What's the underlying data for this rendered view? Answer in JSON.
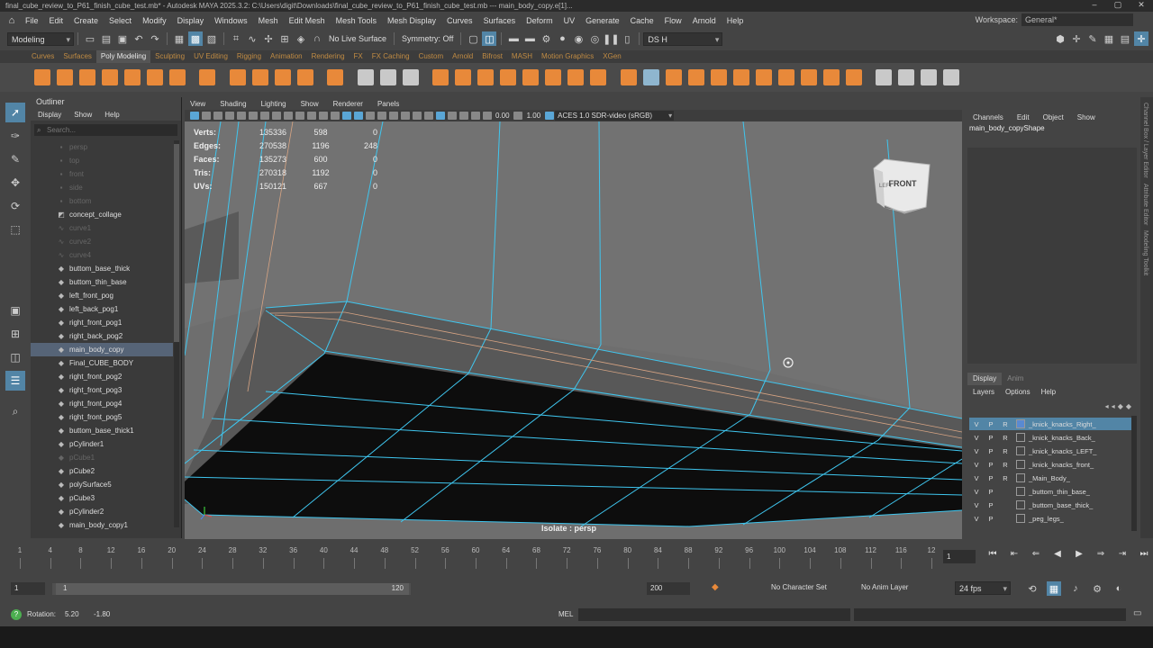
{
  "window": {
    "title": "final_cube_review_to_P61_finish_cube_test.mb* - Autodesk MAYA 2025.3.2: C:\\Users\\digit\\Downloads\\final_cube_review_to_P61_finish_cube_test.mb  ---  main_body_copy.e[1]...",
    "minimize": "–",
    "maximize": "▢",
    "close": "✕"
  },
  "menubar": {
    "items": [
      "File",
      "Edit",
      "Create",
      "Select",
      "Modify",
      "Display",
      "Windows",
      "Mesh",
      "Edit Mesh",
      "Mesh Tools",
      "Mesh Display",
      "Curves",
      "Surfaces",
      "Deform",
      "UV",
      "Generate",
      "Cache",
      "Flow",
      "Arnold",
      "Help"
    ],
    "workspace_label": "Workspace:",
    "workspace_value": "General*"
  },
  "statusline": {
    "menu_set": "Modeling",
    "live_surface": "No Live Surface",
    "symmetry": "Symmetry: Off",
    "user": "DS H"
  },
  "shelf": {
    "tabs": [
      "Curves",
      "Surfaces",
      "Poly Modeling",
      "Sculpting",
      "UV Editing",
      "Rigging",
      "Animation",
      "Rendering",
      "FX",
      "FX Caching",
      "Custom",
      "Arnold",
      "Bifrost",
      "MASH",
      "Motion Graphics",
      "XGen"
    ],
    "active_tab": "Poly Modeling"
  },
  "outliner": {
    "title": "Outliner",
    "menu": [
      "Display",
      "Show",
      "Help"
    ],
    "search_placeholder": "Search...",
    "items": [
      {
        "label": "persp",
        "dim": true,
        "icon": "camera-icon"
      },
      {
        "label": "top",
        "dim": true,
        "icon": "camera-icon"
      },
      {
        "label": "front",
        "dim": true,
        "icon": "camera-icon"
      },
      {
        "label": "side",
        "dim": true,
        "icon": "camera-icon"
      },
      {
        "label": "bottom",
        "dim": true,
        "icon": "camera-icon"
      },
      {
        "label": "concept_collage",
        "dim": false,
        "icon": "image-plane-icon"
      },
      {
        "label": "curve1",
        "dim": true,
        "icon": "curve-icon"
      },
      {
        "label": "curve2",
        "dim": true,
        "icon": "curve-icon"
      },
      {
        "label": "curve4",
        "dim": true,
        "icon": "curve-icon"
      },
      {
        "label": "buttom_base_thick",
        "dim": false,
        "icon": "mesh-icon"
      },
      {
        "label": "buttom_thin_base",
        "dim": false,
        "icon": "mesh-icon"
      },
      {
        "label": "left_front_pog",
        "dim": false,
        "icon": "mesh-icon"
      },
      {
        "label": "left_back_pog1",
        "dim": false,
        "icon": "mesh-icon"
      },
      {
        "label": "right_front_pog1",
        "dim": false,
        "icon": "mesh-icon"
      },
      {
        "label": "right_back_pog2",
        "dim": false,
        "icon": "mesh-icon"
      },
      {
        "label": "main_body_copy",
        "dim": false,
        "icon": "mesh-icon",
        "selected": true
      },
      {
        "label": "Final_CUBE_BODY",
        "dim": false,
        "icon": "mesh-icon"
      },
      {
        "label": "right_front_pog2",
        "dim": false,
        "icon": "mesh-icon"
      },
      {
        "label": "right_front_pog3",
        "dim": false,
        "icon": "mesh-icon"
      },
      {
        "label": "right_front_pog4",
        "dim": false,
        "icon": "mesh-icon"
      },
      {
        "label": "right_front_pog5",
        "dim": false,
        "icon": "mesh-icon"
      },
      {
        "label": "buttom_base_thick1",
        "dim": false,
        "icon": "mesh-icon"
      },
      {
        "label": "pCylinder1",
        "dim": false,
        "icon": "mesh-icon"
      },
      {
        "label": "pCube1",
        "dim": true,
        "icon": "mesh-icon"
      },
      {
        "label": "pCube2",
        "dim": false,
        "icon": "mesh-icon"
      },
      {
        "label": "polySurface5",
        "dim": false,
        "icon": "mesh-icon"
      },
      {
        "label": "pCube3",
        "dim": false,
        "icon": "mesh-icon"
      },
      {
        "label": "pCylinder2",
        "dim": false,
        "icon": "mesh-icon"
      },
      {
        "label": "main_body_copy1",
        "dim": false,
        "icon": "mesh-icon"
      }
    ]
  },
  "viewport": {
    "menu": [
      "View",
      "Shading",
      "Lighting",
      "Show",
      "Renderer",
      "Panels"
    ],
    "exposure": "0.00",
    "gamma": "1.00",
    "color_space": "ACES 1.0 SDR-video (sRGB)",
    "viewcube_front": "FRONT",
    "viewcube_left": "LEFT",
    "isolate_label": "Isolate : persp",
    "hud": [
      {
        "label": "Verts:",
        "a": "135336",
        "b": "598",
        "c": "0"
      },
      {
        "label": "Edges:",
        "a": "270538",
        "b": "1196",
        "c": "248"
      },
      {
        "label": "Faces:",
        "a": "135273",
        "b": "600",
        "c": "0"
      },
      {
        "label": "Tris:",
        "a": "270318",
        "b": "1192",
        "c": "0"
      },
      {
        "label": "UVs:",
        "a": "150121",
        "b": "667",
        "c": "0"
      }
    ]
  },
  "channelbox": {
    "menu": [
      "Channels",
      "Edit",
      "Object",
      "Show"
    ],
    "object_name": "main_body_copyShape"
  },
  "right_strip": [
    "Channel Box / Layer Editor",
    "Attribute Editor",
    "Modeling Toolkit"
  ],
  "layers": {
    "tabs": [
      "Display",
      "Anim"
    ],
    "menu": [
      "Layers",
      "Options",
      "Help"
    ],
    "rows": [
      {
        "v": "V",
        "p": "P",
        "r": "R",
        "name": "_knick_knacks_Right_",
        "selected": true
      },
      {
        "v": "V",
        "p": "P",
        "r": "R",
        "name": "_knick_knacks_Back_"
      },
      {
        "v": "V",
        "p": "P",
        "r": "R",
        "name": "_knick_knacks_LEFT_"
      },
      {
        "v": "V",
        "p": "P",
        "r": "R",
        "name": "_knick_knacks_front_"
      },
      {
        "v": "V",
        "p": "P",
        "r": "R",
        "name": "_Main_Body_"
      },
      {
        "v": "V",
        "p": "P",
        "r": "",
        "name": "_buttom_thin_base_"
      },
      {
        "v": "V",
        "p": "P",
        "r": "",
        "name": "_buttom_base_thick_"
      },
      {
        "v": "V",
        "p": "P",
        "r": "",
        "name": "_peg_legs_"
      }
    ]
  },
  "timeslider": {
    "ticks": [
      "1",
      "4",
      "8",
      "12",
      "16",
      "20",
      "24",
      "28",
      "32",
      "36",
      "40",
      "44",
      "48",
      "52",
      "56",
      "60",
      "64",
      "68",
      "72",
      "76",
      "80",
      "84",
      "88",
      "92",
      "96",
      "100",
      "104",
      "108",
      "112",
      "116",
      "12"
    ],
    "current_frame": "1"
  },
  "range": {
    "start": "1",
    "range_start": "1",
    "range_end": "120",
    "end": "200",
    "character_set": "No Character Set",
    "anim_layer": "No Anim Layer",
    "fps": "24 fps"
  },
  "commandline": {
    "help_label": "Rotation:",
    "rot_a": "5.20",
    "rot_b": "-1.80",
    "lang": "MEL"
  }
}
